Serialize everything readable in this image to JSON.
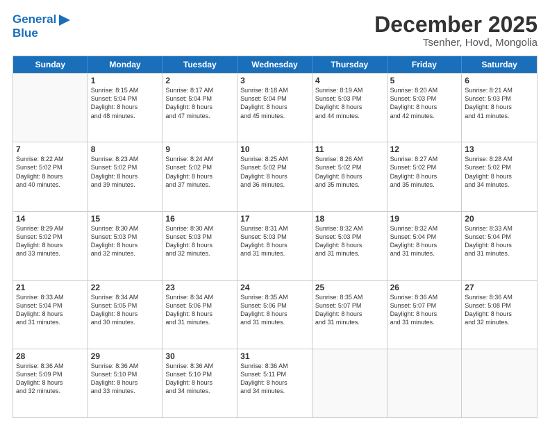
{
  "header": {
    "logo_line1": "General",
    "logo_line2": "Blue",
    "month": "December 2025",
    "location": "Tsenher, Hovd, Mongolia"
  },
  "weekdays": [
    "Sunday",
    "Monday",
    "Tuesday",
    "Wednesday",
    "Thursday",
    "Friday",
    "Saturday"
  ],
  "rows": [
    [
      {
        "day": "",
        "lines": []
      },
      {
        "day": "1",
        "lines": [
          "Sunrise: 8:15 AM",
          "Sunset: 5:04 PM",
          "Daylight: 8 hours",
          "and 48 minutes."
        ]
      },
      {
        "day": "2",
        "lines": [
          "Sunrise: 8:17 AM",
          "Sunset: 5:04 PM",
          "Daylight: 8 hours",
          "and 47 minutes."
        ]
      },
      {
        "day": "3",
        "lines": [
          "Sunrise: 8:18 AM",
          "Sunset: 5:04 PM",
          "Daylight: 8 hours",
          "and 45 minutes."
        ]
      },
      {
        "day": "4",
        "lines": [
          "Sunrise: 8:19 AM",
          "Sunset: 5:03 PM",
          "Daylight: 8 hours",
          "and 44 minutes."
        ]
      },
      {
        "day": "5",
        "lines": [
          "Sunrise: 8:20 AM",
          "Sunset: 5:03 PM",
          "Daylight: 8 hours",
          "and 42 minutes."
        ]
      },
      {
        "day": "6",
        "lines": [
          "Sunrise: 8:21 AM",
          "Sunset: 5:03 PM",
          "Daylight: 8 hours",
          "and 41 minutes."
        ]
      }
    ],
    [
      {
        "day": "7",
        "lines": [
          "Sunrise: 8:22 AM",
          "Sunset: 5:02 PM",
          "Daylight: 8 hours",
          "and 40 minutes."
        ]
      },
      {
        "day": "8",
        "lines": [
          "Sunrise: 8:23 AM",
          "Sunset: 5:02 PM",
          "Daylight: 8 hours",
          "and 39 minutes."
        ]
      },
      {
        "day": "9",
        "lines": [
          "Sunrise: 8:24 AM",
          "Sunset: 5:02 PM",
          "Daylight: 8 hours",
          "and 37 minutes."
        ]
      },
      {
        "day": "10",
        "lines": [
          "Sunrise: 8:25 AM",
          "Sunset: 5:02 PM",
          "Daylight: 8 hours",
          "and 36 minutes."
        ]
      },
      {
        "day": "11",
        "lines": [
          "Sunrise: 8:26 AM",
          "Sunset: 5:02 PM",
          "Daylight: 8 hours",
          "and 35 minutes."
        ]
      },
      {
        "day": "12",
        "lines": [
          "Sunrise: 8:27 AM",
          "Sunset: 5:02 PM",
          "Daylight: 8 hours",
          "and 35 minutes."
        ]
      },
      {
        "day": "13",
        "lines": [
          "Sunrise: 8:28 AM",
          "Sunset: 5:02 PM",
          "Daylight: 8 hours",
          "and 34 minutes."
        ]
      }
    ],
    [
      {
        "day": "14",
        "lines": [
          "Sunrise: 8:29 AM",
          "Sunset: 5:02 PM",
          "Daylight: 8 hours",
          "and 33 minutes."
        ]
      },
      {
        "day": "15",
        "lines": [
          "Sunrise: 8:30 AM",
          "Sunset: 5:03 PM",
          "Daylight: 8 hours",
          "and 32 minutes."
        ]
      },
      {
        "day": "16",
        "lines": [
          "Sunrise: 8:30 AM",
          "Sunset: 5:03 PM",
          "Daylight: 8 hours",
          "and 32 minutes."
        ]
      },
      {
        "day": "17",
        "lines": [
          "Sunrise: 8:31 AM",
          "Sunset: 5:03 PM",
          "Daylight: 8 hours",
          "and 31 minutes."
        ]
      },
      {
        "day": "18",
        "lines": [
          "Sunrise: 8:32 AM",
          "Sunset: 5:03 PM",
          "Daylight: 8 hours",
          "and 31 minutes."
        ]
      },
      {
        "day": "19",
        "lines": [
          "Sunrise: 8:32 AM",
          "Sunset: 5:04 PM",
          "Daylight: 8 hours",
          "and 31 minutes."
        ]
      },
      {
        "day": "20",
        "lines": [
          "Sunrise: 8:33 AM",
          "Sunset: 5:04 PM",
          "Daylight: 8 hours",
          "and 31 minutes."
        ]
      }
    ],
    [
      {
        "day": "21",
        "lines": [
          "Sunrise: 8:33 AM",
          "Sunset: 5:04 PM",
          "Daylight: 8 hours",
          "and 31 minutes."
        ]
      },
      {
        "day": "22",
        "lines": [
          "Sunrise: 8:34 AM",
          "Sunset: 5:05 PM",
          "Daylight: 8 hours",
          "and 30 minutes."
        ]
      },
      {
        "day": "23",
        "lines": [
          "Sunrise: 8:34 AM",
          "Sunset: 5:06 PM",
          "Daylight: 8 hours",
          "and 31 minutes."
        ]
      },
      {
        "day": "24",
        "lines": [
          "Sunrise: 8:35 AM",
          "Sunset: 5:06 PM",
          "Daylight: 8 hours",
          "and 31 minutes."
        ]
      },
      {
        "day": "25",
        "lines": [
          "Sunrise: 8:35 AM",
          "Sunset: 5:07 PM",
          "Daylight: 8 hours",
          "and 31 minutes."
        ]
      },
      {
        "day": "26",
        "lines": [
          "Sunrise: 8:36 AM",
          "Sunset: 5:07 PM",
          "Daylight: 8 hours",
          "and 31 minutes."
        ]
      },
      {
        "day": "27",
        "lines": [
          "Sunrise: 8:36 AM",
          "Sunset: 5:08 PM",
          "Daylight: 8 hours",
          "and 32 minutes."
        ]
      }
    ],
    [
      {
        "day": "28",
        "lines": [
          "Sunrise: 8:36 AM",
          "Sunset: 5:09 PM",
          "Daylight: 8 hours",
          "and 32 minutes."
        ]
      },
      {
        "day": "29",
        "lines": [
          "Sunrise: 8:36 AM",
          "Sunset: 5:10 PM",
          "Daylight: 8 hours",
          "and 33 minutes."
        ]
      },
      {
        "day": "30",
        "lines": [
          "Sunrise: 8:36 AM",
          "Sunset: 5:10 PM",
          "Daylight: 8 hours",
          "and 34 minutes."
        ]
      },
      {
        "day": "31",
        "lines": [
          "Sunrise: 8:36 AM",
          "Sunset: 5:11 PM",
          "Daylight: 8 hours",
          "and 34 minutes."
        ]
      },
      {
        "day": "",
        "lines": []
      },
      {
        "day": "",
        "lines": []
      },
      {
        "day": "",
        "lines": []
      }
    ]
  ]
}
